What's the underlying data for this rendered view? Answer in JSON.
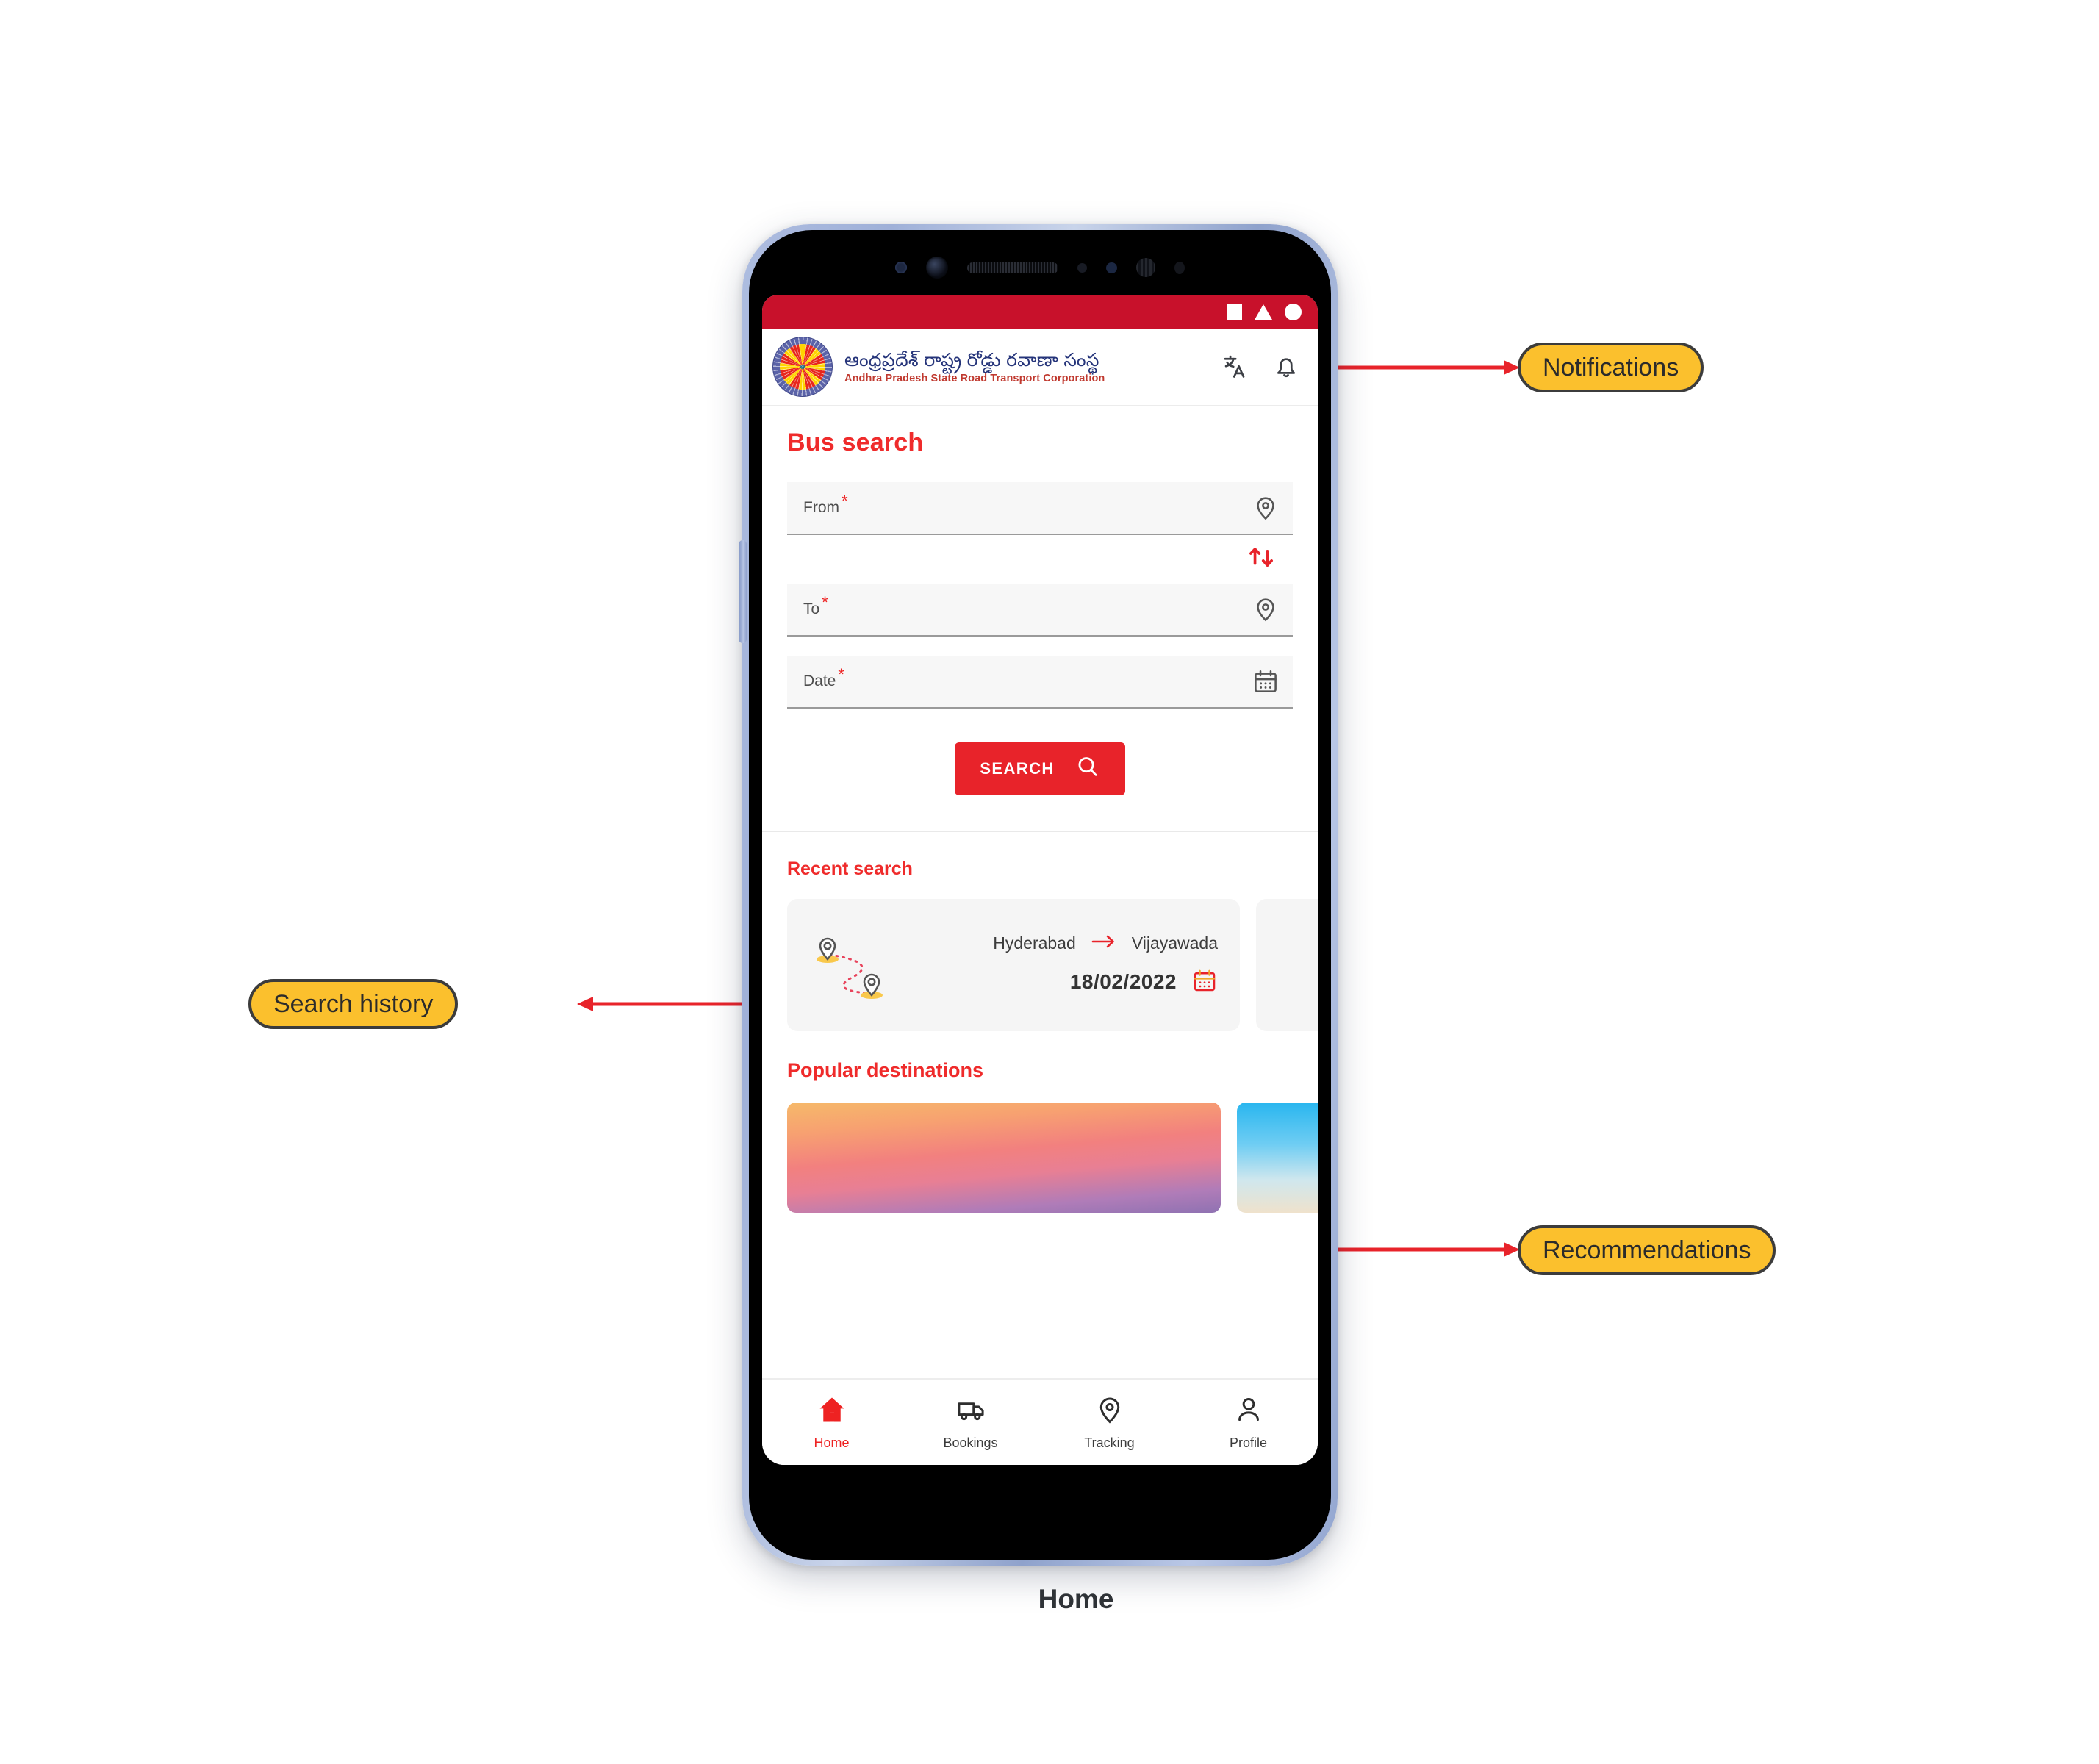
{
  "caption": "Home",
  "phone": {
    "status_bar": {
      "icons": [
        "square-icon",
        "triangle-icon",
        "circle-icon"
      ],
      "background_color": "#c8112b"
    }
  },
  "header": {
    "logo_name": "apsrtc-logo",
    "brand_telugu": "ఆంధ్రప్రదేశ్ రాష్ట్ర రోడ్డు రవాణా సంస్థ",
    "brand_english": "Andhra Pradesh State Road Transport Corporation",
    "actions": [
      {
        "name": "translate-icon",
        "label": "Translate"
      },
      {
        "name": "notifications-bell-icon",
        "label": "Notifications"
      }
    ]
  },
  "bus_search": {
    "title": "Bus search",
    "fields": [
      {
        "label": "From",
        "required_mark": "*",
        "value": "",
        "icon": "location-pin-icon"
      },
      {
        "label": "To",
        "required_mark": "*",
        "value": "",
        "icon": "location-pin-icon"
      },
      {
        "label": "Date",
        "required_mark": "*",
        "value": "",
        "icon": "calendar-icon"
      }
    ],
    "swap_icon": "swap-vertical-arrows-icon",
    "search_button": {
      "label": "SEARCH",
      "icon": "search-icon"
    }
  },
  "recent_search": {
    "title": "Recent search",
    "items": [
      {
        "origin": "Hyderabad",
        "destination": "Vijayawada",
        "date": "18/02/2022",
        "arrow_icon": "arrow-right-icon",
        "calendar_icon": "calendar-icon"
      }
    ]
  },
  "popular_destinations": {
    "title": "Popular destinations",
    "cards": [
      {
        "name": "destination-card-sunset"
      },
      {
        "name": "destination-card-sky"
      }
    ]
  },
  "bottom_nav": {
    "items": [
      {
        "label": "Home",
        "icon": "home-icon",
        "active": true
      },
      {
        "label": "Bookings",
        "icon": "bus-icon",
        "active": false
      },
      {
        "label": "Tracking",
        "icon": "location-pin-icon",
        "active": false
      },
      {
        "label": "Profile",
        "icon": "person-icon",
        "active": false
      }
    ]
  },
  "annotations": {
    "notifications": "Notifications",
    "search_history": "Search history",
    "recommendations": "Recommendations"
  },
  "colors": {
    "brand_red": "#e8232a",
    "status_bar_red": "#c8112b",
    "heading_red": "#ef2b2b",
    "callout_yellow": "#fbc02d",
    "telugu_blue": "#25347a"
  }
}
